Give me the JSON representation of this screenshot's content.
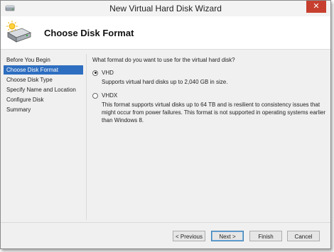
{
  "window": {
    "title": "New Virtual Hard Disk Wizard",
    "close_label": "✕"
  },
  "header": {
    "title": "Choose Disk Format"
  },
  "nav": {
    "items": [
      {
        "label": "Before You Begin",
        "active": false
      },
      {
        "label": "Choose Disk Format",
        "active": true
      },
      {
        "label": "Choose Disk Type",
        "active": false
      },
      {
        "label": "Specify Name and Location",
        "active": false
      },
      {
        "label": "Configure Disk",
        "active": false
      },
      {
        "label": "Summary",
        "active": false
      }
    ]
  },
  "content": {
    "question": "What format do you want to use for the virtual hard disk?",
    "options": [
      {
        "label": "VHD",
        "selected": true,
        "description": "Supports virtual hard disks up to 2,040 GB in size."
      },
      {
        "label": "VHDX",
        "selected": false,
        "description": "This format supports virtual disks up to 64 TB and is resilient to consistency issues that might occur from power failures. This format is not supported in operating systems earlier than Windows 8."
      }
    ]
  },
  "buttons": {
    "previous": "< Previous",
    "next": "Next >",
    "finish": "Finish",
    "cancel": "Cancel"
  },
  "colors": {
    "selection": "#2e6ec0",
    "close": "#c7402f"
  },
  "icons": {
    "window": "disk-icon",
    "header": "disk-sparkle-icon"
  }
}
